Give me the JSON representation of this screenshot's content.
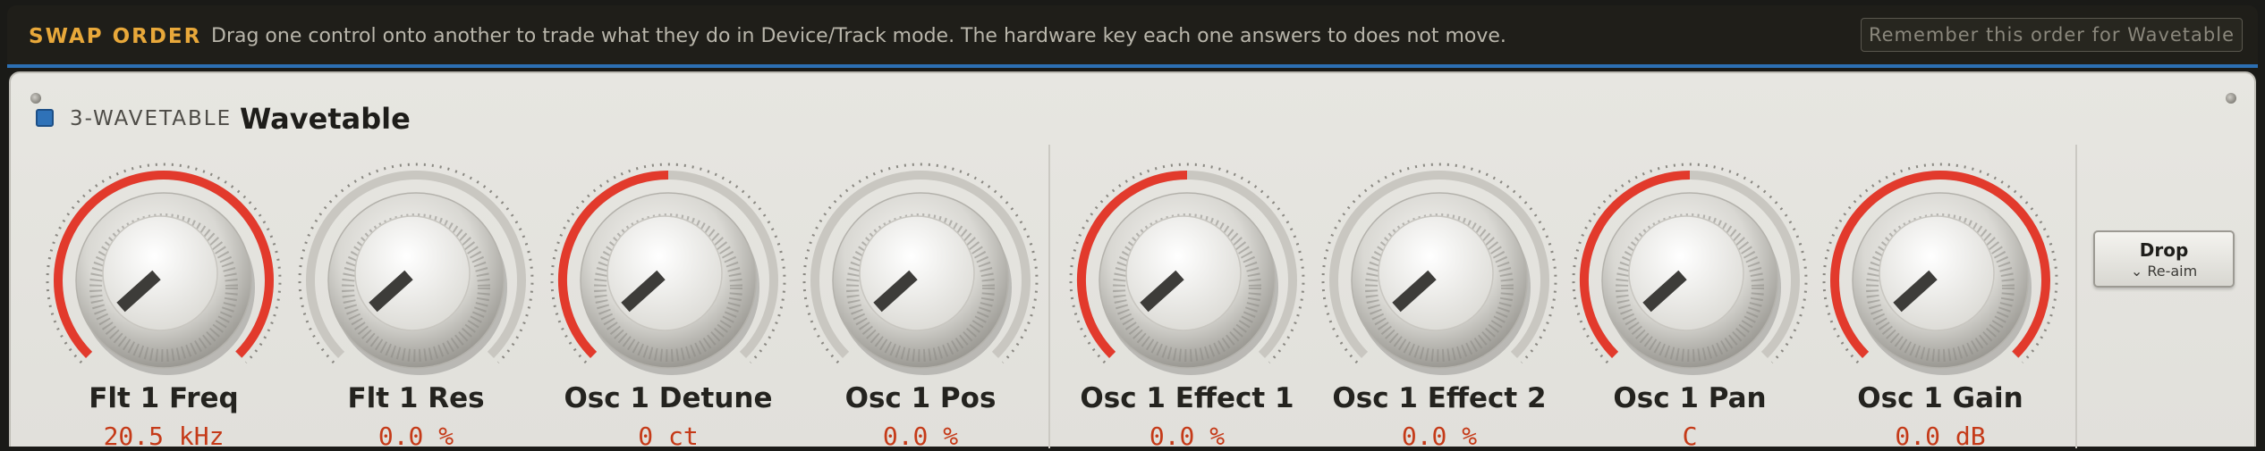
{
  "banner": {
    "title": "SWAP ORDER",
    "instructions": "Drag one control onto another to trade what they do in Device/Track mode. The hardware key each one answers to does not move.",
    "remember_button": "Remember this order for Wavetable"
  },
  "device": {
    "id_label": "3-WAVETABLE",
    "name": "Wavetable",
    "enabled": true
  },
  "knobs": [
    {
      "name": "Flt 1 Freq",
      "value": "20.5 kHz",
      "level": 1.0
    },
    {
      "name": "Flt 1 Res",
      "value": "0.0 %",
      "level": 0.0
    },
    {
      "name": "Osc 1 Detune",
      "value": "0 ct",
      "level": 0.5
    },
    {
      "name": "Osc 1 Pos",
      "value": "0.0 %",
      "level": 0.0
    },
    {
      "name": "Osc 1 Effect 1",
      "value": "0.0 %",
      "level": 0.5
    },
    {
      "name": "Osc 1 Effect 2",
      "value": "0.0 %",
      "level": 0.0
    },
    {
      "name": "Osc 1 Pan",
      "value": "C",
      "level": 0.5
    },
    {
      "name": "Osc 1 Gain",
      "value": "0.0 dB",
      "level": 1.0
    }
  ],
  "drop_button": {
    "label": "Drop",
    "sub_label": "⌄ Re-aim"
  },
  "colors": {
    "accent": "#e8a83a",
    "arc_active": "#e23a2c",
    "arc_inactive": "#c9c7c1",
    "value_text": "#c53a18",
    "selection_blue": "#2c6fb3"
  }
}
